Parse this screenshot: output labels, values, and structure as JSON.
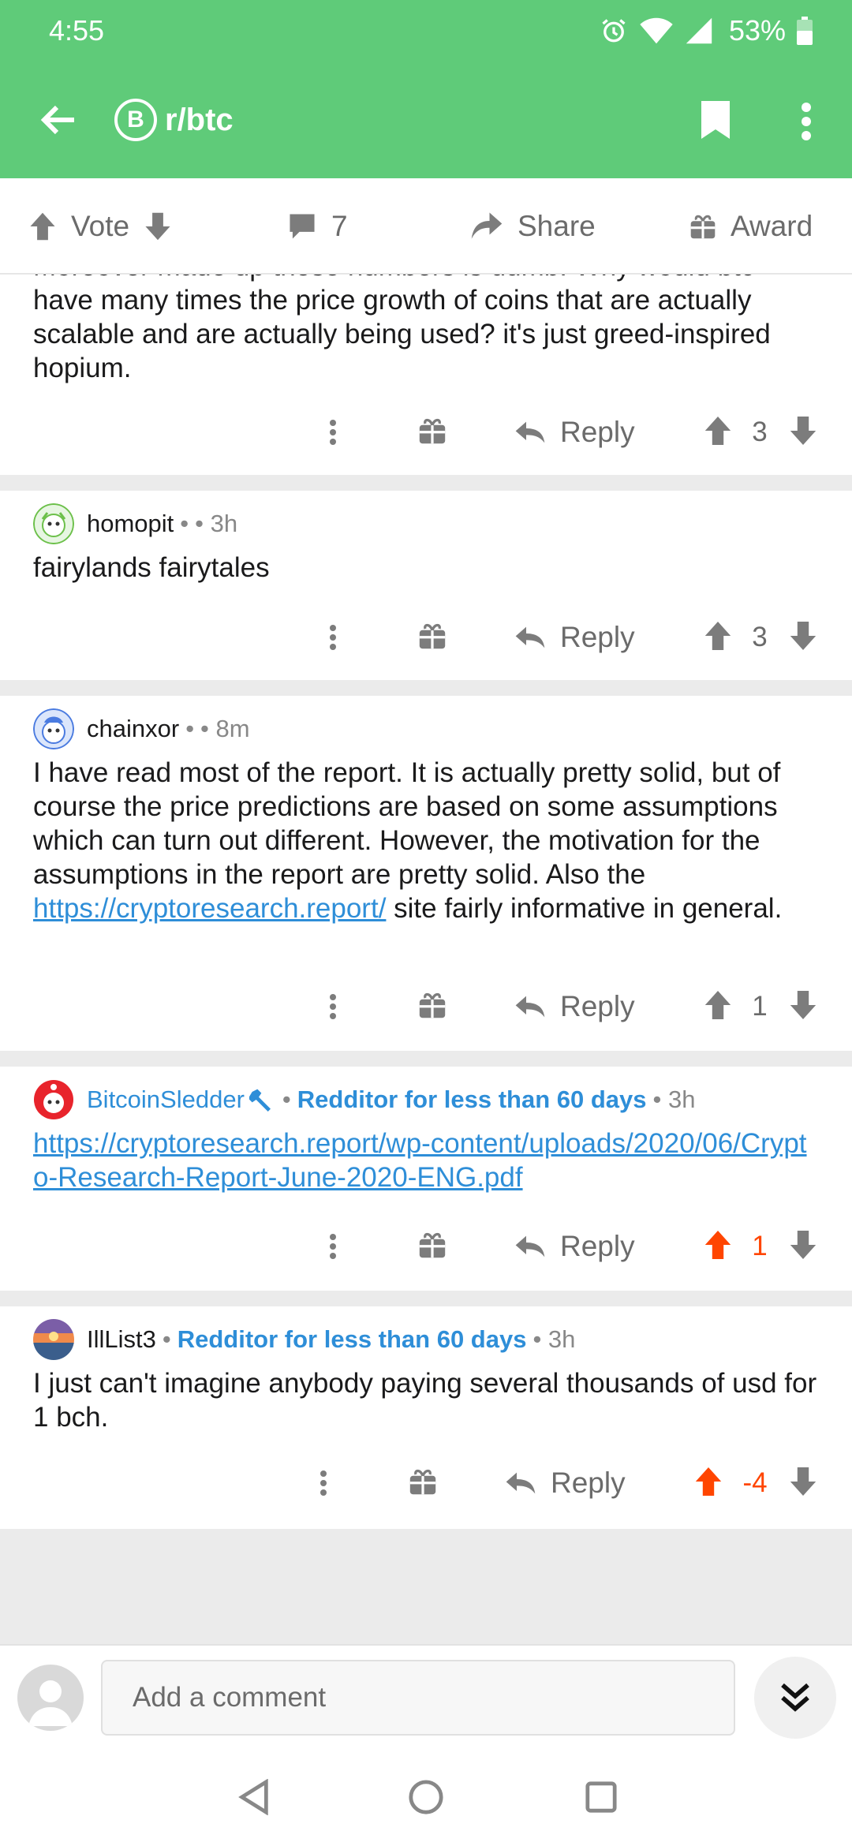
{
  "status_bar": {
    "time": "4:55",
    "battery": "53%"
  },
  "app_bar": {
    "subreddit": "r/btc",
    "sub_icon_glyph": "B"
  },
  "post_actions": {
    "vote_label": "Vote",
    "comment_count": "7",
    "share_label": "Share",
    "award_label": "Award"
  },
  "comments": [
    {
      "body_partial_top": "Moreover made up these numbers is dumb.  Why would btc",
      "body": "have many times the price growth of coins that are actually scalable and are actually being used?  it's just greed-inspired hopium.",
      "reply_label": "Reply",
      "score": "3"
    },
    {
      "author": "homopit",
      "separator": "•",
      "age": "• 3h",
      "body": "fairylands fairytales",
      "reply_label": "Reply",
      "score": "3"
    },
    {
      "author": "chainxor",
      "separator": "•",
      "age": "• 8m",
      "body_before": "I have read most of the report. It is actually pretty solid, but of course the price predictions are based on some assumptions which can turn out different. However, the motivation for the assumptions in the report are pretty solid. Also the ",
      "link": "https://cryptoresearch.report/",
      "body_after": " site fairly informative in general.",
      "reply_label": "Reply",
      "score": "1"
    },
    {
      "author": "BitcoinSledder",
      "flair": "Redditor for less than 60 days",
      "age": "• 3h",
      "link": "https://cryptoresearch.report/wp-content/uploads/2020/06/Crypto-Research-Report-June-2020-ENG.pdf",
      "reply_label": "Reply",
      "score": "1"
    },
    {
      "author": "IllList3",
      "flair": "Redditor for less than 60 days",
      "age": "• 3h",
      "body": "I just can't imagine anybody paying several thousands of usd for 1 bch.",
      "reply_label": "Reply",
      "score": "-4"
    }
  ],
  "comment_bar": {
    "placeholder": "Add a comment"
  },
  "colors": {
    "app_green": "#5fcb79",
    "upvote_orange": "#ff4500",
    "link_blue": "#2e8ed8"
  },
  "icons": [
    "back-arrow",
    "bitcoin",
    "bookmark",
    "more-vertical",
    "upvote",
    "downvote",
    "comment",
    "share",
    "gift",
    "reply"
  ]
}
